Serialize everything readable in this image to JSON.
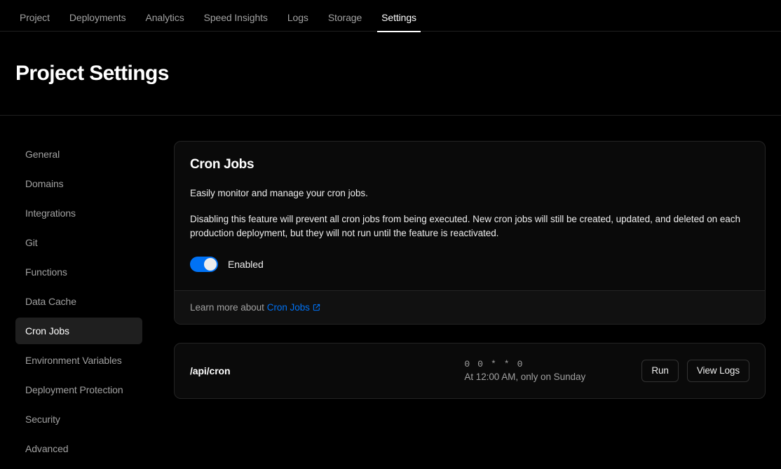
{
  "topnav": {
    "tabs": [
      {
        "label": "Project",
        "active": false
      },
      {
        "label": "Deployments",
        "active": false
      },
      {
        "label": "Analytics",
        "active": false
      },
      {
        "label": "Speed Insights",
        "active": false
      },
      {
        "label": "Logs",
        "active": false
      },
      {
        "label": "Storage",
        "active": false
      },
      {
        "label": "Settings",
        "active": true
      }
    ]
  },
  "header": {
    "title": "Project Settings"
  },
  "sidebar": {
    "items": [
      {
        "label": "General",
        "active": false
      },
      {
        "label": "Domains",
        "active": false
      },
      {
        "label": "Integrations",
        "active": false
      },
      {
        "label": "Git",
        "active": false
      },
      {
        "label": "Functions",
        "active": false
      },
      {
        "label": "Data Cache",
        "active": false
      },
      {
        "label": "Cron Jobs",
        "active": true
      },
      {
        "label": "Environment Variables",
        "active": false
      },
      {
        "label": "Deployment Protection",
        "active": false
      },
      {
        "label": "Security",
        "active": false
      },
      {
        "label": "Advanced",
        "active": false
      }
    ]
  },
  "cron_card": {
    "title": "Cron Jobs",
    "lead": "Easily monitor and manage your cron jobs.",
    "description": "Disabling this feature will prevent all cron jobs from being executed. New cron jobs will still be created, updated, and deleted on each production deployment, but they will not run until the feature is reactivated.",
    "toggle_label": "Enabled",
    "toggle_on": true,
    "footer_text": "Learn more about",
    "footer_link_label": "Cron Jobs",
    "footer_link_icon": "external-link-icon"
  },
  "cron_row": {
    "path": "/api/cron",
    "expression": "0 0 * * 0",
    "human_readable": "At 12:00 AM, only on Sunday",
    "run_label": "Run",
    "view_logs_label": "View Logs"
  },
  "colors": {
    "page_background": "#000000",
    "card_background": "#0a0a0a",
    "card_border": "#242424",
    "accent_blue": "#0072f5",
    "active_sidebar_background": "#1f1f1f",
    "muted_text": "#a1a1a1",
    "primary_text": "#ededed"
  }
}
